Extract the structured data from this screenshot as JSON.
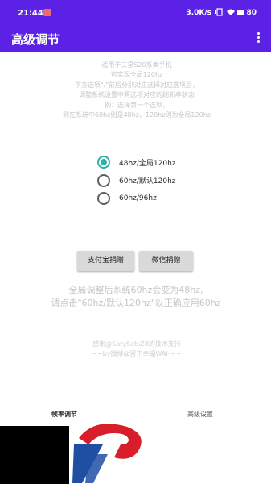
{
  "status_bar": {
    "time": "21:44",
    "speed": "3.0K/s",
    "battery": "80"
  },
  "app_bar": {
    "title": "高级调节"
  },
  "intro_lines": [
    "适用于三星S20系类手机",
    "可实现全局120hz",
    "下方选项\"/\"前后分别对应选择对应选项后，",
    "调整系统设置中两选项对应的刷新率状态",
    "例：选择第一个选项，",
    "则在系统中60hz则是48hz，120hz则为全局120hz"
  ],
  "options": [
    {
      "label": "48hz/全局120hz",
      "checked": true
    },
    {
      "label": "60hz/默认120hz",
      "checked": false
    },
    {
      "label": "60hz/96hz",
      "checked": false
    }
  ],
  "buttons": {
    "alipay": "支付宝捐赠",
    "wechat": "微信捐赠"
  },
  "note_lines": [
    "全局调整后系统60hz会变为48hz,",
    "请点击\"60hz/默认120hz\"以正确应用60hz"
  ],
  "thanks_lines": [
    "感谢@SatySatsZ8的技术支持",
    "~~by微博@留下幸福WAH~~"
  ],
  "bottom_nav": {
    "fps": "帧率调节",
    "advanced": "高级设置"
  },
  "colors": {
    "primary": "#5b22e6",
    "accent": "#2ab3a6"
  }
}
